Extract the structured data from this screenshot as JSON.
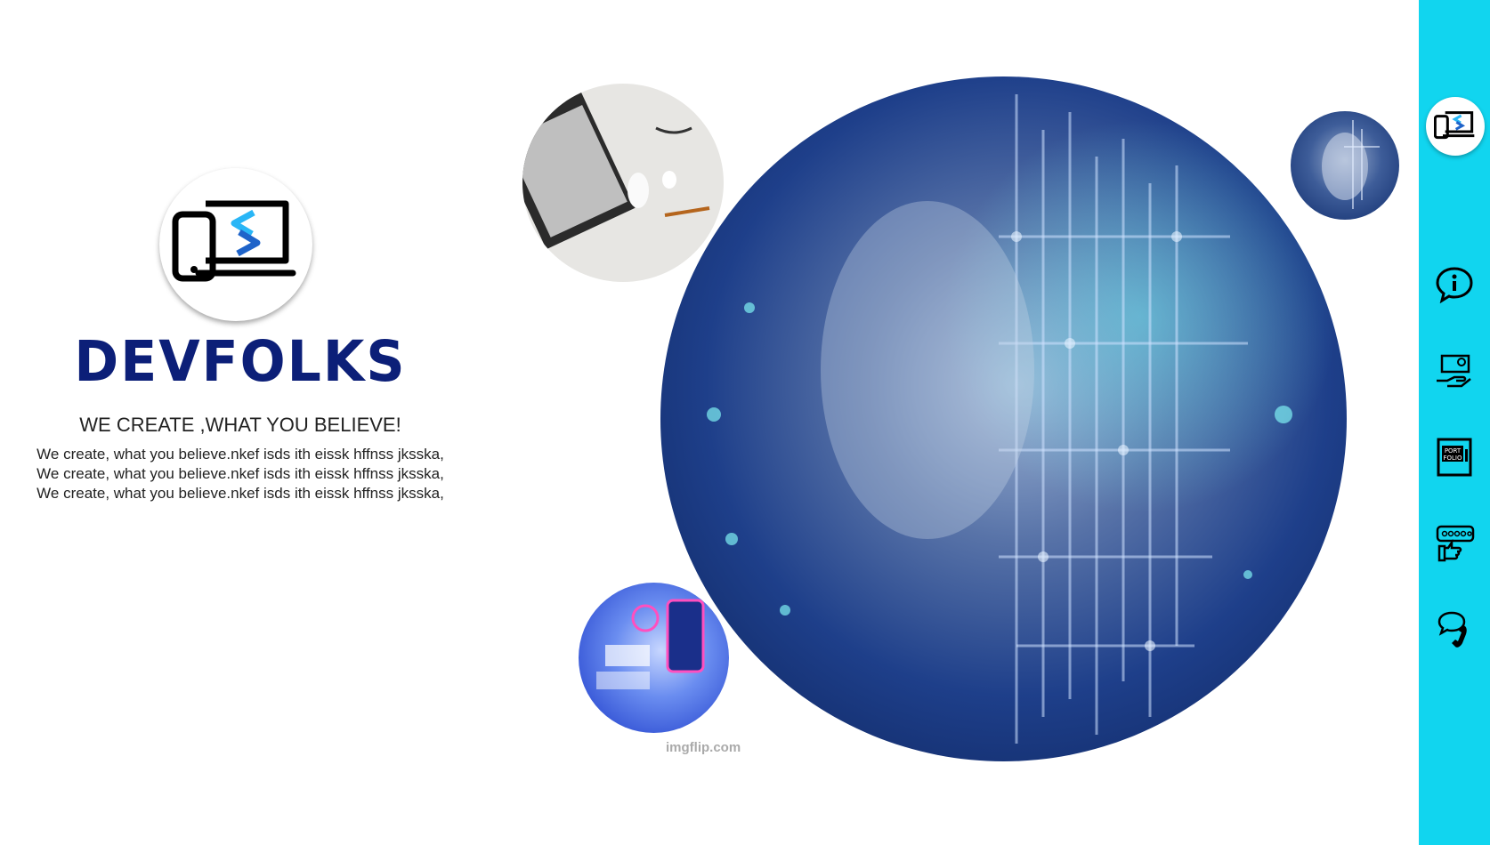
{
  "brand": {
    "name": "DEVFOLKS",
    "tagline": "WE CREATE ,WHAT YOU BELIEVE!",
    "description": "We create, what you believe.nkef isds ith eissk hffnss jksska, We create, what you believe.nkef isds ith eissk hffnss jksska, We create, what you believe.nkef isds ith eissk hffnss jksska,"
  },
  "hero": {
    "watermark": "imgflip.com",
    "images": [
      "ai-face-circuit",
      "laptop-desk",
      "isometric-phone",
      "ai-face-thumb"
    ]
  },
  "nav": {
    "items": [
      {
        "icon": "devices-logo-icon",
        "active": true
      },
      {
        "icon": "info-chat-icon",
        "active": false
      },
      {
        "icon": "services-hand-icon",
        "active": false
      },
      {
        "icon": "portfolio-icon",
        "active": false
      },
      {
        "icon": "rating-thumb-icon",
        "active": false
      },
      {
        "icon": "contact-phone-icon",
        "active": false
      }
    ]
  },
  "colors": {
    "accent": "#11d5ef",
    "brand": "#0c1f78",
    "logo_blue": "#1f8ae0"
  }
}
